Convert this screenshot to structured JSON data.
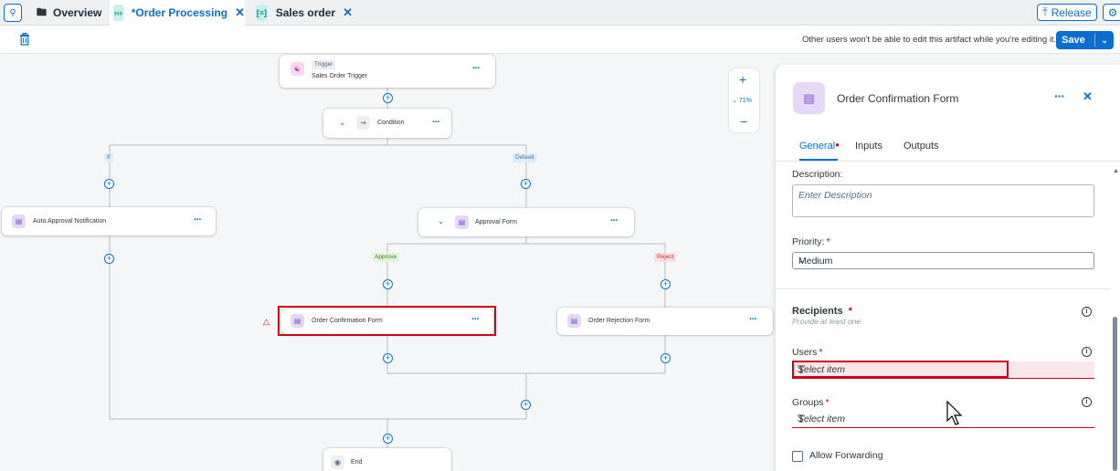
{
  "tabs": [
    {
      "label": "Overview",
      "icon": "folder-open-icon"
    },
    {
      "label": "*Order Processing",
      "icon": "process-icon",
      "active": true
    },
    {
      "label": "Sales order",
      "icon": "form-icon"
    }
  ],
  "header": {
    "release_label": "Release"
  },
  "toolbar": {
    "notice": "Other users won't be able to edit this artifact while you're editing it.",
    "save_label": "Save"
  },
  "canvas": {
    "zoom_level": "71%",
    "nodes": {
      "trigger_tag": "Trigger",
      "trigger": "Sales Order Trigger",
      "condition": "Condition",
      "auto_approval": "Auto Approval Notification",
      "approval_form": "Approval Form",
      "order_confirmation": "Order Confirmation Form",
      "order_rejection": "Order Rejection Form",
      "end": "End"
    },
    "branches": {
      "if": "If",
      "default": "Default",
      "approve": "Approve",
      "reject": "Reject"
    }
  },
  "panel": {
    "title": "Order Confirmation Form",
    "tabs": [
      "General",
      "Inputs",
      "Outputs"
    ],
    "description_label": "Description:",
    "description_placeholder": "Enter Description",
    "priority_label": "Priority:",
    "priority_value": "Medium",
    "recipients_title": "Recipients",
    "recipients_subtitle": "Provide at least one",
    "users_label": "Users",
    "users_placeholder": "Select item",
    "groups_label": "Groups",
    "groups_placeholder": "Select item",
    "allow_forwarding_label": "Allow Forwarding"
  },
  "colors": {
    "accent": "#0a6ed1",
    "error": "#d0021b",
    "node_icon_bg": "#e5d9f7"
  }
}
